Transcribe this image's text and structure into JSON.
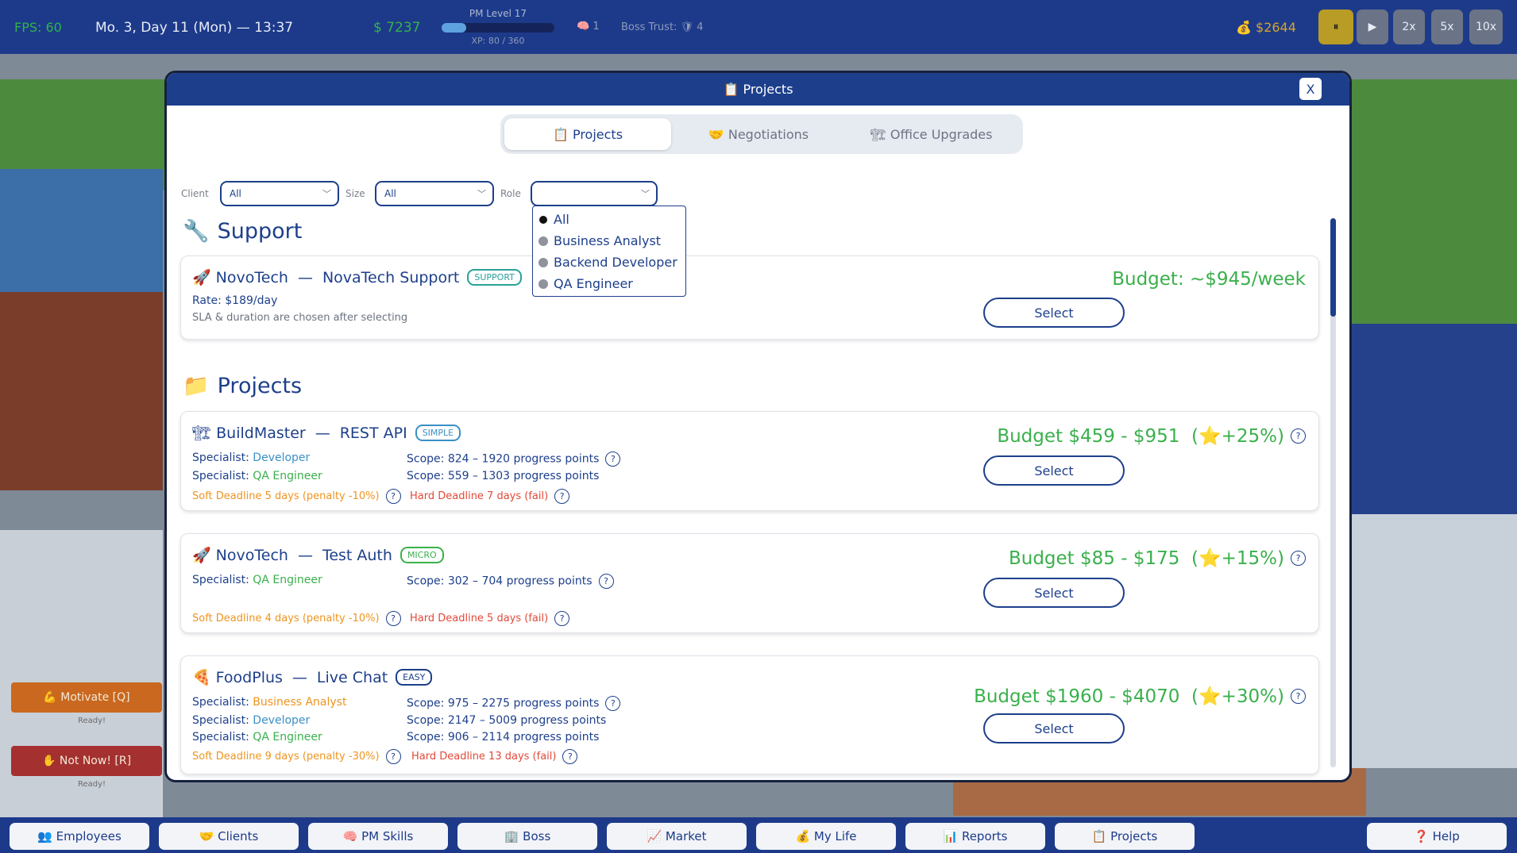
{
  "topbar": {
    "fps": "FPS: 60",
    "date": "Mo. 3, Day 11 (Mon) — 13:37",
    "cash": "$ 7237",
    "pm_level": "PM Level 17",
    "pm_xp_text": "XP: 80 / 360",
    "pm_xp_progress": 0.22,
    "brain_value": "1",
    "boss_trust": "Boss Trust: 🛡 4",
    "money2": "💰 $2644",
    "speed_buttons": [
      "⏸",
      "▶",
      "2x",
      "5x",
      "10x"
    ],
    "active_speed": "⏸"
  },
  "sidebar_left": {
    "motivate_label": "💪 Motivate [Q]",
    "motivate_status": "Ready!",
    "notnow_label": "✋ Not Now! [R]",
    "notnow_status": "Ready!"
  },
  "modal": {
    "title": "📋 Projects",
    "close_label": "X",
    "tabs": [
      {
        "label": "📋 Projects",
        "active": true
      },
      {
        "label": "🤝 Negotiations",
        "active": false
      },
      {
        "label": "🏗 Office Upgrades",
        "active": false
      }
    ],
    "filters": {
      "client_label": "Client",
      "client_value": "All",
      "size_label": "Size",
      "size_value": "All",
      "role_label": "Role",
      "role_value": ""
    },
    "role_options": [
      {
        "label": "All",
        "selected": true
      },
      {
        "label": "Business Analyst",
        "selected": false
      },
      {
        "label": "Backend Developer",
        "selected": false
      },
      {
        "label": "QA Engineer",
        "selected": false
      }
    ],
    "support_section": {
      "icon": "🔧",
      "title": "Support",
      "card": {
        "icon": "🚀",
        "client": "NovoTech",
        "name": "NovaTech Support",
        "badge": "SUPPORT",
        "rate": "Rate: $189/day",
        "note": "SLA & duration are chosen after selecting",
        "budget": "Budget: ~$945/week",
        "select_label": "Select"
      }
    },
    "projects_section": {
      "icon": "📁",
      "title": "Projects",
      "cards": [
        {
          "icon": "🏗",
          "client": "BuildMaster",
          "name": "REST API",
          "badge": "SIMPLE",
          "specialists": [
            {
              "label": "Specialist:",
              "role": "Developer",
              "scope": "Scope: 824 – 1920 progress points"
            },
            {
              "label": "Specialist:",
              "role": "QA Engineer",
              "scope": "Scope: 559 – 1303 progress points"
            }
          ],
          "soft_deadline": "Soft Deadline 5 days (penalty -10%)",
          "hard_deadline": "Hard Deadline 7 days (fail)",
          "budget": "Budget $459 - $951",
          "bonus": "+25%",
          "select_label": "Select"
        },
        {
          "icon": "🚀",
          "client": "NovoTech",
          "name": "Test Auth",
          "badge": "MICRO",
          "specialists": [
            {
              "label": "Specialist:",
              "role": "QA Engineer",
              "scope": "Scope: 302 – 704 progress points"
            }
          ],
          "soft_deadline": "Soft Deadline 4 days (penalty -10%)",
          "hard_deadline": "Hard Deadline 5 days (fail)",
          "budget": "Budget $85 - $175",
          "bonus": "+15%",
          "select_label": "Select"
        },
        {
          "icon": "🍕",
          "client": "FoodPlus",
          "name": "Live Chat",
          "badge": "EASY",
          "specialists": [
            {
              "label": "Specialist:",
              "role": "Business Analyst",
              "scope": "Scope: 975 – 2275 progress points"
            },
            {
              "label": "Specialist:",
              "role": "Developer",
              "scope": "Scope: 2147 – 5009 progress points"
            },
            {
              "label": "Specialist:",
              "role": "QA Engineer",
              "scope": "Scope: 906 – 2114 progress points"
            }
          ],
          "soft_deadline": "Soft Deadline 9 days (penalty -30%)",
          "hard_deadline": "Hard Deadline 13 days (fail)",
          "budget": "Budget $1960 - $4070",
          "bonus": "+30%",
          "select_label": "Select"
        }
      ]
    },
    "dash": "—",
    "star": "⭐",
    "help_mark": "?"
  },
  "bottom_nav": [
    {
      "label": "👥 Employees"
    },
    {
      "label": "🤝 Clients"
    },
    {
      "label": "🧠 PM Skills"
    },
    {
      "label": "🏢 Boss"
    },
    {
      "label": "📈 Market"
    },
    {
      "label": "💰 My Life"
    },
    {
      "label": "📊 Reports"
    },
    {
      "label": "📋 Projects"
    }
  ],
  "help_button": "❓ Help",
  "colors": {
    "primary": "#1d3f8b",
    "budget_green": "#3ab04c",
    "specialist_blue": "#3a90c7",
    "soft_orange": "#ee9420",
    "hard_red": "#e2493a",
    "speed_active": "#b89c25"
  }
}
